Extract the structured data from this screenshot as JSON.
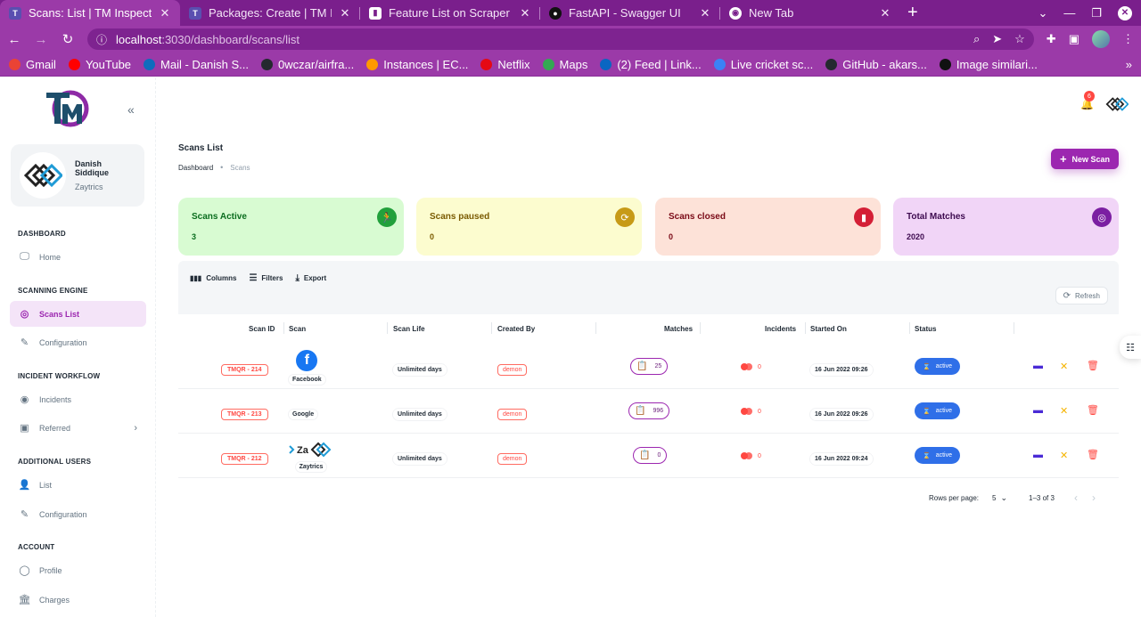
{
  "browser": {
    "tabs": [
      {
        "title": "Scans: List | TM Inspector",
        "active": true
      },
      {
        "title": "Packages: Create | TM Insp",
        "active": false
      },
      {
        "title": "Feature List on Scraper | T",
        "active": false
      },
      {
        "title": "FastAPI - Swagger UI",
        "active": false
      },
      {
        "title": "New Tab",
        "active": false
      }
    ],
    "url_host": "localhost",
    "url_path": ":3030/dashboard/scans/list",
    "bookmarks": [
      {
        "label": "Gmail",
        "color": "#ea4335"
      },
      {
        "label": "YouTube",
        "color": "#ff0000"
      },
      {
        "label": "Mail - Danish S...",
        "color": "#0f6cbd"
      },
      {
        "label": "0wczar/airfra...",
        "color": "#24292f"
      },
      {
        "label": "Instances | EC...",
        "color": "#ff9900"
      },
      {
        "label": "Netflix",
        "color": "#e50914"
      },
      {
        "label": "Maps",
        "color": "#34a853"
      },
      {
        "label": "(2) Feed | Link...",
        "color": "#0a66c2"
      },
      {
        "label": "Live cricket sc...",
        "color": "#3b82f6"
      },
      {
        "label": "GitHub - akars...",
        "color": "#24292f"
      },
      {
        "label": "Image similari...",
        "color": "#111111"
      }
    ]
  },
  "sidebar": {
    "user_name": "Danish Siddique",
    "user_org": "Zaytrics",
    "sections": {
      "dashboard": "DASHBOARD",
      "scanning": "SCANNING ENGINE",
      "incident": "INCIDENT WORKFLOW",
      "users": "ADDITIONAL USERS",
      "account": "ACCOUNT"
    },
    "items": {
      "home": "Home",
      "scans_list": "Scans List",
      "scan_config": "Configuration",
      "incidents": "Incidents",
      "referred": "Referred",
      "users_list": "List",
      "users_config": "Configuration",
      "profile": "Profile",
      "charges": "Charges"
    }
  },
  "header": {
    "notification_count": "6",
    "page_title": "Scans List",
    "breadcrumb": {
      "root": "Dashboard",
      "current": "Scans"
    },
    "new_scan_label": "New Scan"
  },
  "stats": [
    {
      "label": "Scans Active",
      "value": "3",
      "bg": "#d8fbd2",
      "color": "#0a6d1e",
      "icon_bg": "#22a03c"
    },
    {
      "label": "Scans paused",
      "value": "0",
      "bg": "#fcfccf",
      "color": "#7a5a00",
      "icon_bg": "#c79a17"
    },
    {
      "label": "Scans closed",
      "value": "0",
      "bg": "#fde2d8",
      "color": "#7a0916",
      "icon_bg": "#d41f36"
    },
    {
      "label": "Total Matches",
      "value": "2020",
      "bg": "#f1d5f7",
      "color": "#3d0a4f",
      "icon_bg": "#7b1fa2"
    }
  ],
  "toolbar": {
    "columns": "Columns",
    "filters": "Filters",
    "export": "Export",
    "refresh": "Refresh"
  },
  "table": {
    "headers": {
      "scan_id": "Scan ID",
      "scan": "Scan",
      "scan_life": "Scan Life",
      "created_by": "Created By",
      "matches": "Matches",
      "incidents": "Incidents",
      "started_on": "Started On",
      "status": "Status"
    },
    "rows": [
      {
        "id": "TMQR - 214",
        "scan": "Facebook",
        "life": "Unlimited days",
        "creator": "demon",
        "matches": "25",
        "incidents": "0",
        "started": "16 Jun 2022 09:26",
        "status": "active"
      },
      {
        "id": "TMQR - 213",
        "scan": "Google",
        "life": "Unlimited days",
        "creator": "demon",
        "matches": "996",
        "incidents": "0",
        "started": "16 Jun 2022 09:26",
        "status": "active"
      },
      {
        "id": "TMQR - 212",
        "scan": "Zaytrics",
        "life": "Unlimited days",
        "creator": "demon",
        "matches": "0",
        "incidents": "0",
        "started": "16 Jun 2022 09:24",
        "status": "active"
      }
    ]
  },
  "pagination": {
    "rows_per_page_label": "Rows per page:",
    "rows_per_page": "5",
    "range": "1–3 of 3"
  },
  "colors": {
    "accent": "#9c27b0",
    "status_active": "#2f6fe8",
    "danger": "#ff4842"
  }
}
